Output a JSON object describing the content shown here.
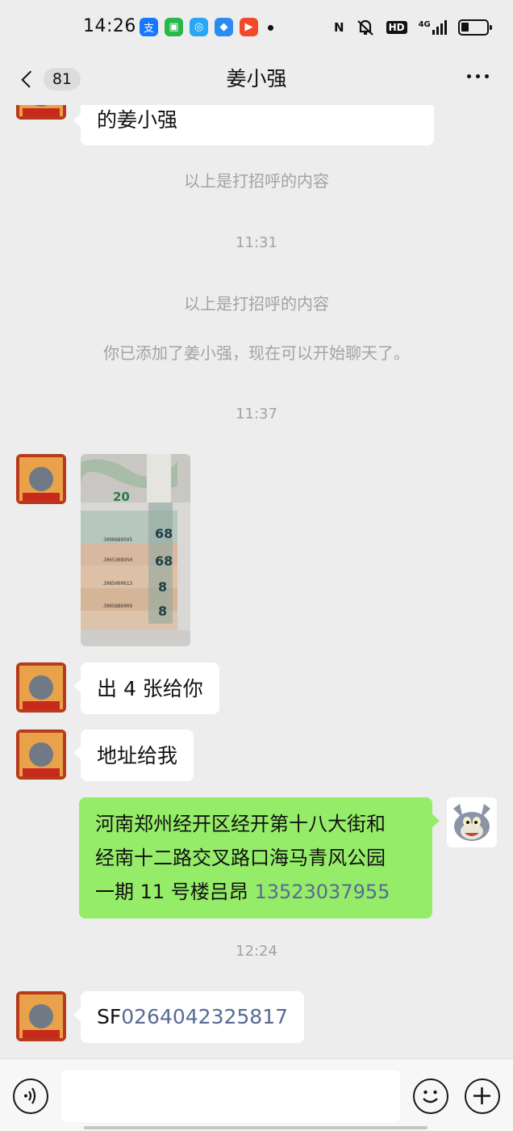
{
  "status_bar": {
    "time": "14:26",
    "app_icons": [
      {
        "name": "alipay-icon",
        "glyph": "支",
        "color": "#1677ff"
      },
      {
        "name": "message-app-icon",
        "glyph": "▣",
        "color": "#28b84a"
      },
      {
        "name": "browser-app-icon",
        "glyph": "◎",
        "color": "#27a7f5"
      },
      {
        "name": "feather-app-icon",
        "glyph": "◆",
        "color": "#2b8cf0"
      },
      {
        "name": "video-app-icon",
        "glyph": "▶",
        "color": "#f04a2a"
      }
    ],
    "network": "4G",
    "hd": "HD",
    "nfc": "N"
  },
  "header": {
    "back_label": "<",
    "unread_count": "81",
    "title": "姜小强"
  },
  "messages": {
    "first_partial": "的姜小强",
    "greeting_note_1": "以上是打招呼的内容",
    "time_1": "11:31",
    "greeting_note_2": "以上是打招呼的内容",
    "added_note": "你已添加了姜小强，现在可以开始聊天了。",
    "time_2": "11:37",
    "photo_banner_number": "20",
    "photo_numbers": [
      "68",
      "68",
      "8",
      "8"
    ],
    "photo_serials": [
      "J090689505",
      "J065308950",
      "J085099613",
      "J005886909"
    ],
    "msg_offer": "出 4 张给你",
    "msg_address_request": "地址给我",
    "msg_address_line1": "河南郑州经开区经开第十八大街和",
    "msg_address_line2": "经南十二路交叉路口海马青风公园",
    "msg_address_line3_text": "一期 11 号楼吕昂 ",
    "msg_address_phone": "13523037955",
    "time_3": "12:24",
    "msg_tracking_prefix": "SF",
    "msg_tracking_number": "0264042325817"
  },
  "input_bar": {
    "placeholder": ""
  },
  "colors": {
    "background": "#ededed",
    "outgoing_bubble": "#95ec69",
    "incoming_bubble": "#ffffff",
    "link": "#576b95",
    "system_text": "#a3a3a3"
  }
}
